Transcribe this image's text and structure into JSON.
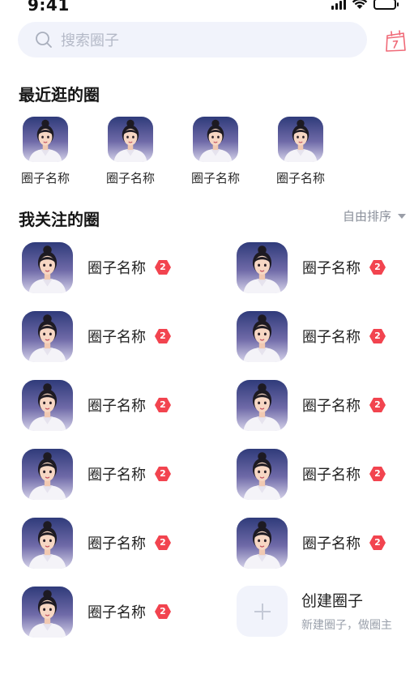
{
  "status_bar": {
    "time": "9:41"
  },
  "search": {
    "placeholder": "搜索圈子"
  },
  "recent": {
    "title": "最近逛的圈",
    "items": [
      {
        "label": "圈子名称"
      },
      {
        "label": "圈子名称"
      },
      {
        "label": "圈子名称"
      },
      {
        "label": "圈子名称"
      }
    ]
  },
  "followed": {
    "title": "我关注的圈",
    "sort_label": "自由排序",
    "items": [
      {
        "name": "圈子名称",
        "badge": "2"
      },
      {
        "name": "圈子名称",
        "badge": "2"
      },
      {
        "name": "圈子名称",
        "badge": "2"
      },
      {
        "name": "圈子名称",
        "badge": "2"
      },
      {
        "name": "圈子名称",
        "badge": "2"
      },
      {
        "name": "圈子名称",
        "badge": "2"
      },
      {
        "name": "圈子名称",
        "badge": "2"
      },
      {
        "name": "圈子名称",
        "badge": "2"
      },
      {
        "name": "圈子名称",
        "badge": "2"
      },
      {
        "name": "圈子名称",
        "badge": "2"
      },
      {
        "name": "圈子名称",
        "badge": "2"
      }
    ],
    "create": {
      "title": "创建圈子",
      "subtitle": "新建圈子，做圈主"
    }
  },
  "colors": {
    "badge": "#f2444f",
    "accent_icon": "#f06a78",
    "search_bg": "#f1f3fb"
  },
  "icons": {
    "search": "search-icon",
    "calendar": "calendar-icon",
    "create": "plus-icon"
  }
}
